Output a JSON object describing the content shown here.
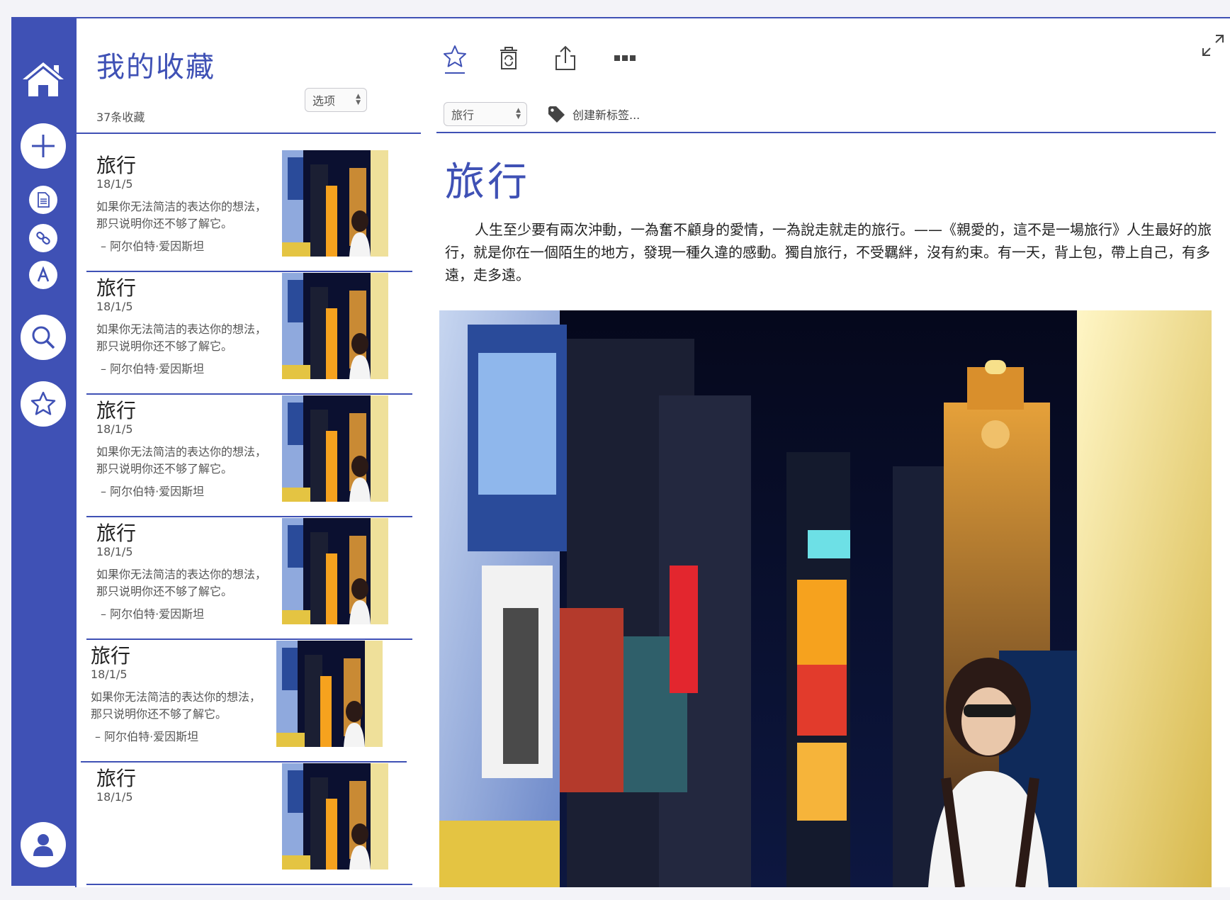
{
  "list": {
    "title": "我的收藏",
    "count": "37条收藏",
    "options_select": "选项",
    "cards": [
      {
        "title": "旅行",
        "date": "18/1/5",
        "excerpt": "如果你无法简洁的表达你的想法，那只说明你还不够了解它。",
        "author": "– 阿尔伯特·爱因斯坦"
      },
      {
        "title": "旅行",
        "date": "18/1/5",
        "excerpt": "如果你无法简洁的表达你的想法，那只说明你还不够了解它。",
        "author": "– 阿尔伯特·爱因斯坦"
      },
      {
        "title": "旅行",
        "date": "18/1/5",
        "excerpt": "如果你无法简洁的表达你的想法，那只说明你还不够了解它。",
        "author": "– 阿尔伯特·爱因斯坦"
      },
      {
        "title": "旅行",
        "date": "18/1/5",
        "excerpt": "如果你无法简洁的表达你的想法，那只说明你还不够了解它。",
        "author": "– 阿尔伯特·爱因斯坦"
      },
      {
        "title": "旅行",
        "date": "18/1/5",
        "excerpt": "如果你无法简洁的表达你的想法，那只说明你还不够了解它。",
        "author": "– 阿尔伯特·爱因斯坦"
      },
      {
        "title": "旅行",
        "date": "18/1/5",
        "excerpt": "",
        "author": ""
      }
    ]
  },
  "detail": {
    "category_select": "旅行",
    "new_tag": "创建新标签...",
    "title": "旅行",
    "body": "人生至少要有兩次沖動，一為奮不顧身的愛情，一為說走就走的旅行。——《親愛的，這不是一場旅行》人生最好的旅行，就是你在一個陌生的地方，發現一種久違的感動。獨自旅行，不受羈絆，沒有約束。有一天，背上包，帶上自己，有多遠，走多遠。"
  },
  "colors": {
    "accent": "#3f51b5",
    "sidebar_bg": "#3f51b5",
    "text": "#222222",
    "muted": "#555555"
  },
  "icons": {
    "sidebar": [
      "home-icon",
      "plus-icon",
      "document-icon",
      "link-icon",
      "font-icon",
      "search-icon",
      "star-icon",
      "user-icon"
    ],
    "toolbar": [
      "star-icon",
      "recycle-bin-icon",
      "share-icon",
      "more-icon",
      "expand-icon",
      "tag-icon"
    ]
  }
}
